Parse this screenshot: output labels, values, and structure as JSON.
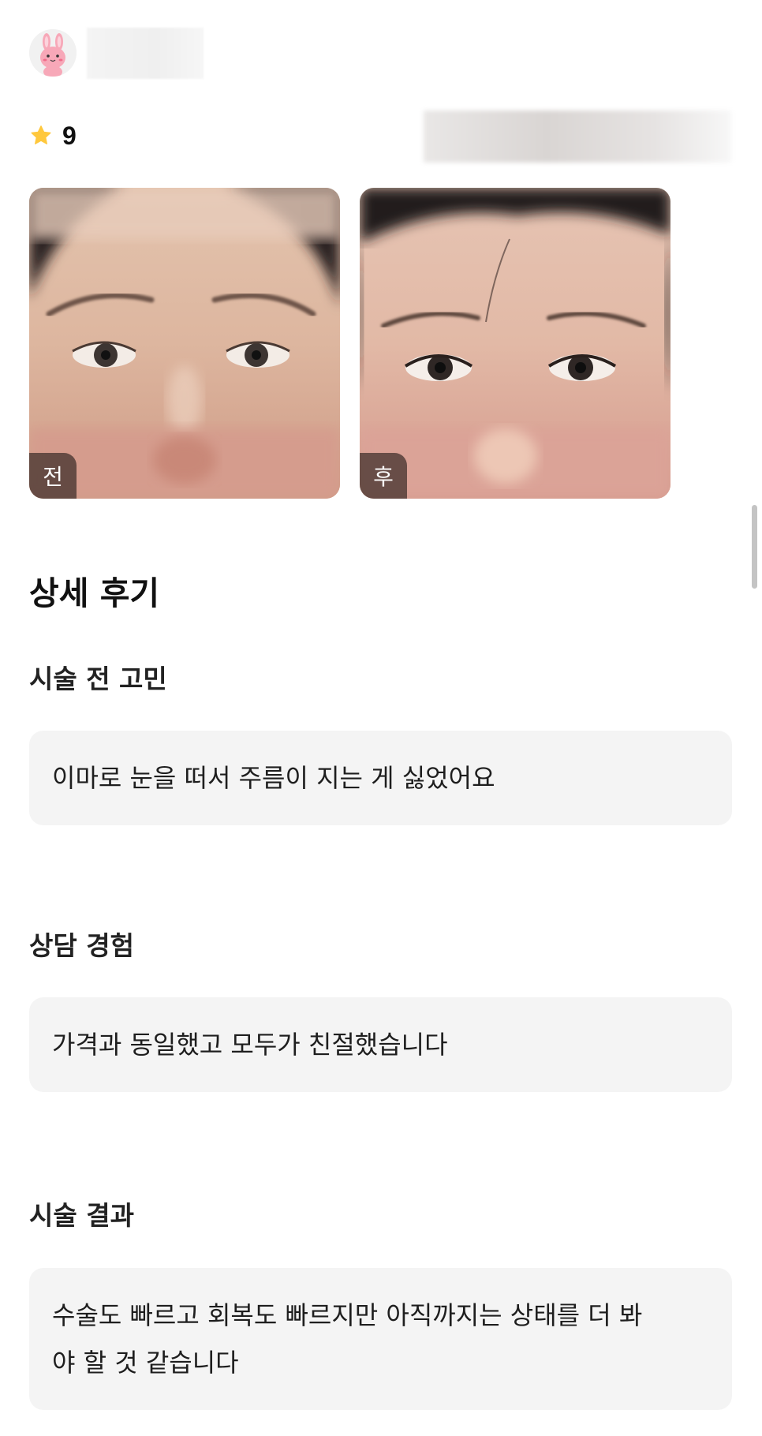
{
  "review": {
    "rating": "9",
    "photos": {
      "before_label": "전",
      "after_label": "후"
    },
    "detail_title": "상세 후기",
    "sections": [
      {
        "label": "시술 전 고민",
        "text": "이마로 눈을 떠서 주름이 지는 게 싫었어요"
      },
      {
        "label": "상담 경험",
        "text": "가격과 동일했고 모두가 친절했습니다"
      },
      {
        "label": "시술 결과",
        "text": "수술도 빠르고 회복도 빠르지만 아직까지는 상태를 더 봐야 할 것 같습니다"
      }
    ]
  },
  "colors": {
    "star": "#FFC83D",
    "answer_background": "#F4F4F4",
    "avatar_pink": "#F7A8B8"
  },
  "icons": {
    "avatar": "bunny-avatar-icon",
    "rating": "star-icon"
  }
}
